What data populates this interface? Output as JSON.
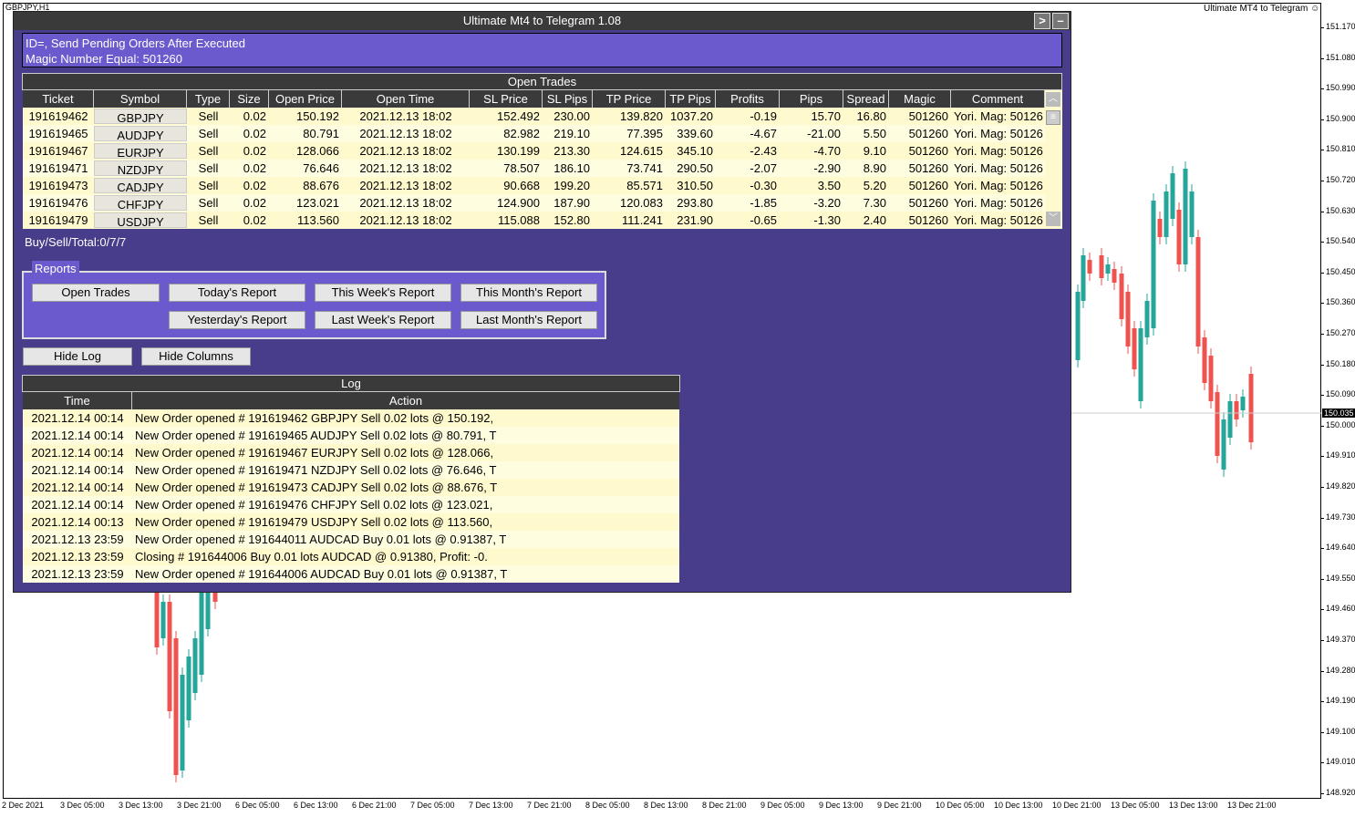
{
  "chart": {
    "symbol": "GBPJPY,H1",
    "brand": "Ultimate MT4 to Telegram",
    "current_price": "150.035",
    "price_ticks": [
      "151.170",
      "151.080",
      "150.990",
      "150.900",
      "150.810",
      "150.720",
      "150.630",
      "150.540",
      "150.450",
      "150.360",
      "150.270",
      "150.180",
      "150.090",
      "150.000",
      "149.910",
      "149.820",
      "149.730",
      "149.640",
      "149.550",
      "149.460",
      "149.370",
      "149.280",
      "149.190",
      "149.100",
      "149.010",
      "148.920"
    ],
    "time_ticks": [
      "2 Dec 2021",
      "3 Dec 05:00",
      "3 Dec 13:00",
      "3 Dec 21:00",
      "6 Dec 05:00",
      "6 Dec 13:00",
      "6 Dec 21:00",
      "7 Dec 05:00",
      "7 Dec 13:00",
      "7 Dec 21:00",
      "8 Dec 05:00",
      "8 Dec 13:00",
      "8 Dec 21:00",
      "9 Dec 05:00",
      "9 Dec 13:00",
      "9 Dec 21:00",
      "10 Dec 05:00",
      "10 Dec 13:00",
      "10 Dec 21:00",
      "13 Dec 05:00",
      "13 Dec 13:00",
      "13 Dec 21:00"
    ],
    "colors": {
      "bull": "#26a69a",
      "bear": "#ef5350"
    }
  },
  "panel": {
    "title": "Ultimate Mt4 to Telegram 1.08",
    "expand_label": ">",
    "minimize_label": "–",
    "info_line1": "ID=, Send Pending Orders After Executed",
    "info_line2": "Magic Number Equal: 501260",
    "colors": {
      "panel_bg": "#483d8b",
      "info_bg": "#6a5acd",
      "header_bg": "#3a3a3a",
      "row_bg": "#fffacd"
    }
  },
  "trades": {
    "title": "Open Trades",
    "columns": [
      "Ticket",
      "Symbol",
      "Type",
      "Size",
      "Open Price",
      "Open Time",
      "SL Price",
      "SL Pips",
      "TP Price",
      "TP Pips",
      "Profits",
      "Pips",
      "Spread",
      "Magic",
      "Comment"
    ],
    "rows": [
      [
        "191619462",
        "GBPJPY",
        "Sell",
        "0.02",
        "150.192",
        "2021.12.13 18:02",
        "152.492",
        "230.00",
        "139.820",
        "1037.20",
        "-0.19",
        "15.70",
        "16.80",
        "501260",
        "Yori. Mag: 50126"
      ],
      [
        "191619465",
        "AUDJPY",
        "Sell",
        "0.02",
        "80.791",
        "2021.12.13 18:02",
        "82.982",
        "219.10",
        "77.395",
        "339.60",
        "-4.67",
        "-21.00",
        "5.50",
        "501260",
        "Yori. Mag: 50126"
      ],
      [
        "191619467",
        "EURJPY",
        "Sell",
        "0.02",
        "128.066",
        "2021.12.13 18:02",
        "130.199",
        "213.30",
        "124.615",
        "345.10",
        "-2.43",
        "-4.70",
        "9.10",
        "501260",
        "Yori. Mag: 50126"
      ],
      [
        "191619471",
        "NZDJPY",
        "Sell",
        "0.02",
        "76.646",
        "2021.12.13 18:02",
        "78.507",
        "186.10",
        "73.741",
        "290.50",
        "-2.07",
        "-2.90",
        "8.90",
        "501260",
        "Yori. Mag: 50126"
      ],
      [
        "191619473",
        "CADJPY",
        "Sell",
        "0.02",
        "88.676",
        "2021.12.13 18:02",
        "90.668",
        "199.20",
        "85.571",
        "310.50",
        "-0.30",
        "3.50",
        "5.20",
        "501260",
        "Yori. Mag: 50126"
      ],
      [
        "191619476",
        "CHFJPY",
        "Sell",
        "0.02",
        "123.021",
        "2021.12.13 18:02",
        "124.900",
        "187.90",
        "120.083",
        "293.80",
        "-1.85",
        "-3.20",
        "7.30",
        "501260",
        "Yori. Mag: 50126"
      ],
      [
        "191619479",
        "USDJPY",
        "Sell",
        "0.02",
        "113.560",
        "2021.12.13 18:02",
        "115.088",
        "152.80",
        "111.241",
        "231.90",
        "-0.65",
        "-1.30",
        "2.40",
        "501260",
        "Yori. Mag: 50126"
      ]
    ],
    "summary": "Buy/Sell/Total:0/7/7"
  },
  "reports": {
    "label": "Reports",
    "buttons": [
      "Open Trades",
      "Today's Report",
      "This Week's Report",
      "This Month's Report",
      "Yesterday's Report",
      "Last Week's Report",
      "Last Month's Report"
    ]
  },
  "actions": {
    "hide_log": "Hide Log",
    "hide_columns": "Hide Columns"
  },
  "log": {
    "title": "Log",
    "columns": [
      "Time",
      "Action"
    ],
    "rows": [
      [
        "2021.12.14 00:14",
        "New Order opened # 191619462  GBPJPY Sell 0.02 lots @ 150.192,"
      ],
      [
        "2021.12.14 00:14",
        "New Order opened # 191619465  AUDJPY Sell 0.02 lots @ 80.791, T"
      ],
      [
        "2021.12.14 00:14",
        "New Order opened # 191619467  EURJPY Sell 0.02 lots @ 128.066,"
      ],
      [
        "2021.12.14 00:14",
        "New Order opened # 191619471  NZDJPY Sell 0.02 lots @ 76.646, T"
      ],
      [
        "2021.12.14 00:14",
        "New Order opened # 191619473  CADJPY Sell 0.02 lots @ 88.676, T"
      ],
      [
        "2021.12.14 00:14",
        "New Order opened # 191619476  CHFJPY Sell 0.02 lots @ 123.021,"
      ],
      [
        "2021.12.14 00:13",
        "New Order opened # 191619479  USDJPY Sell 0.02 lots @ 113.560,"
      ],
      [
        "2021.12.13 23:59",
        "New Order opened # 191644011  AUDCAD Buy 0.01 lots @ 0.91387, T"
      ],
      [
        "2021.12.13 23:59",
        "Closing # 191644006 Buy 0.01 lots AUDCAD @ 0.91380, Profit: -0."
      ],
      [
        "2021.12.13 23:59",
        "New Order opened # 191644006  AUDCAD Buy 0.01 lots @ 0.91387, T"
      ]
    ]
  }
}
